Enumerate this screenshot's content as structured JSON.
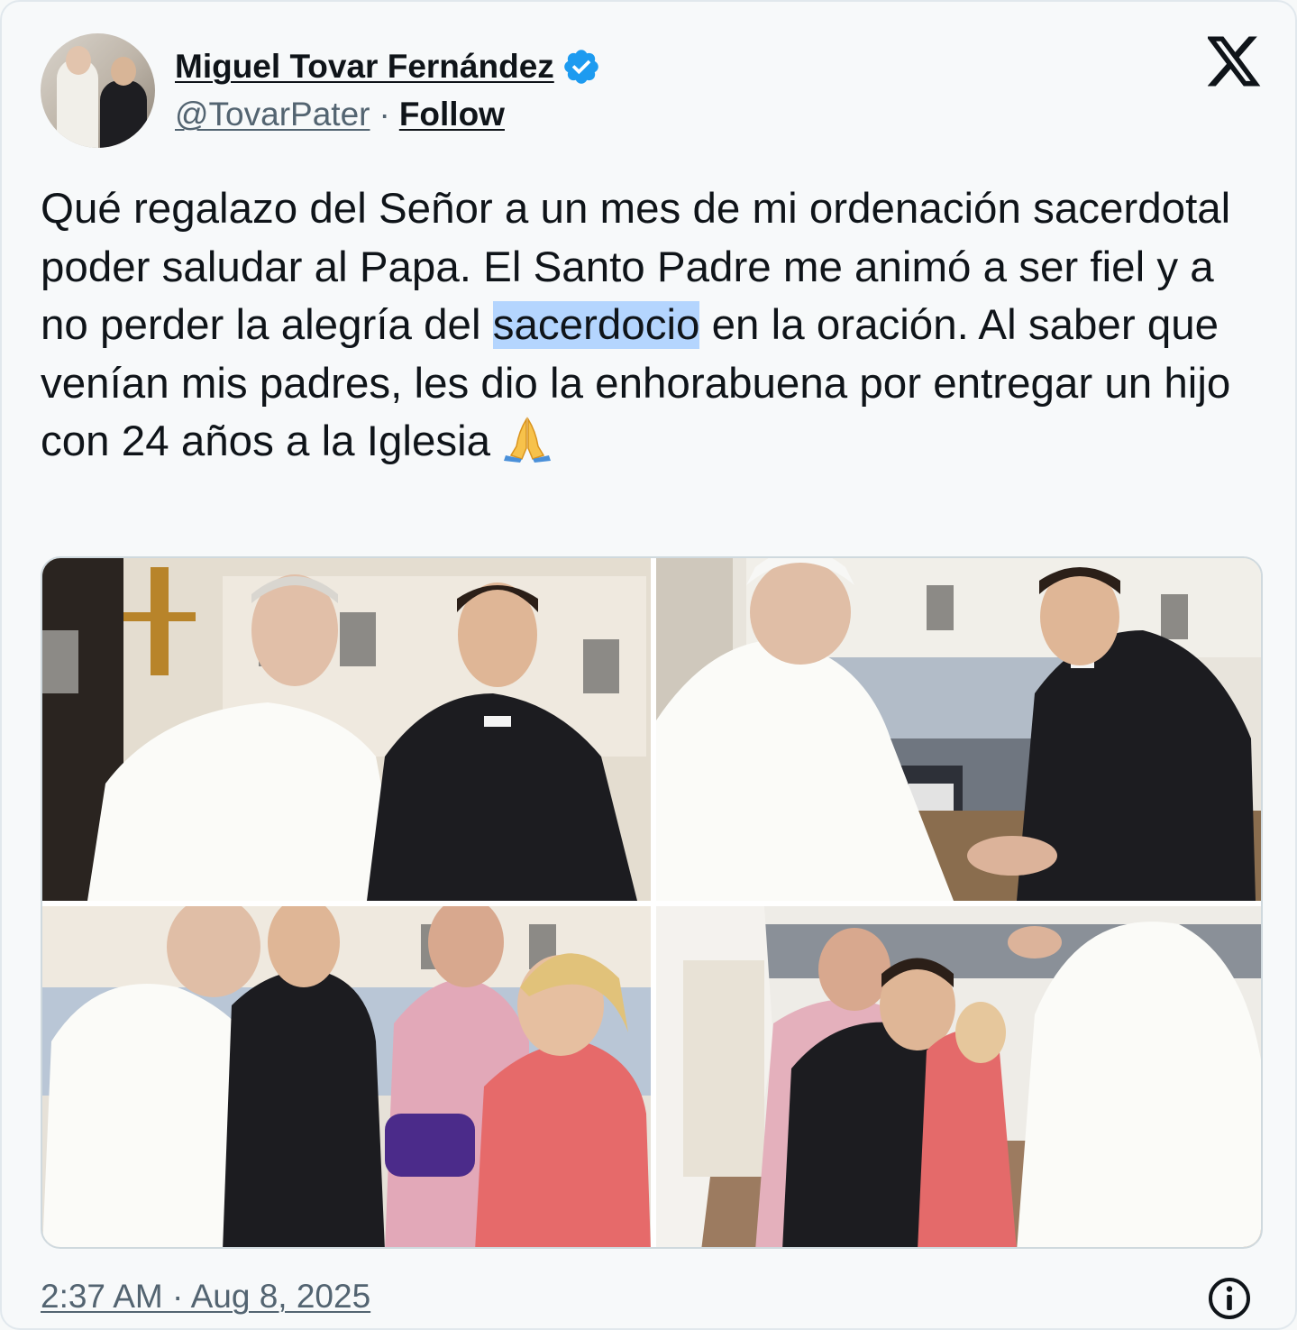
{
  "author": {
    "display_name": "Miguel Tovar Fernández",
    "handle": "@TovarPater",
    "separator": "·",
    "follow_label": "Follow",
    "verified": true
  },
  "tweet": {
    "text_before": "Qué regalazo del Señor a un mes de mi ordenación sacerdotal poder saludar al Papa. El Santo Padre me animó a ser fiel y a no perder la alegría del ",
    "highlighted": "sacerdocio",
    "text_after": " en la oración. Al saber que venían mis padres, les dio la enhorabuena por entregar un hijo con 24 años a la Iglesia ",
    "emoji": "folded-hands-emoji"
  },
  "media": {
    "photos": [
      "photo-1",
      "photo-2",
      "photo-3",
      "photo-4"
    ]
  },
  "footer": {
    "timestamp": "2:37 AM · Aug 8, 2025"
  },
  "colors": {
    "verified_blue": "#1d9bf0",
    "highlight": "#b4d5fe",
    "secondary_text": "#536471"
  },
  "icons": {
    "platform": "x-logo-icon",
    "verified": "verified-badge-icon",
    "info": "info-icon"
  }
}
